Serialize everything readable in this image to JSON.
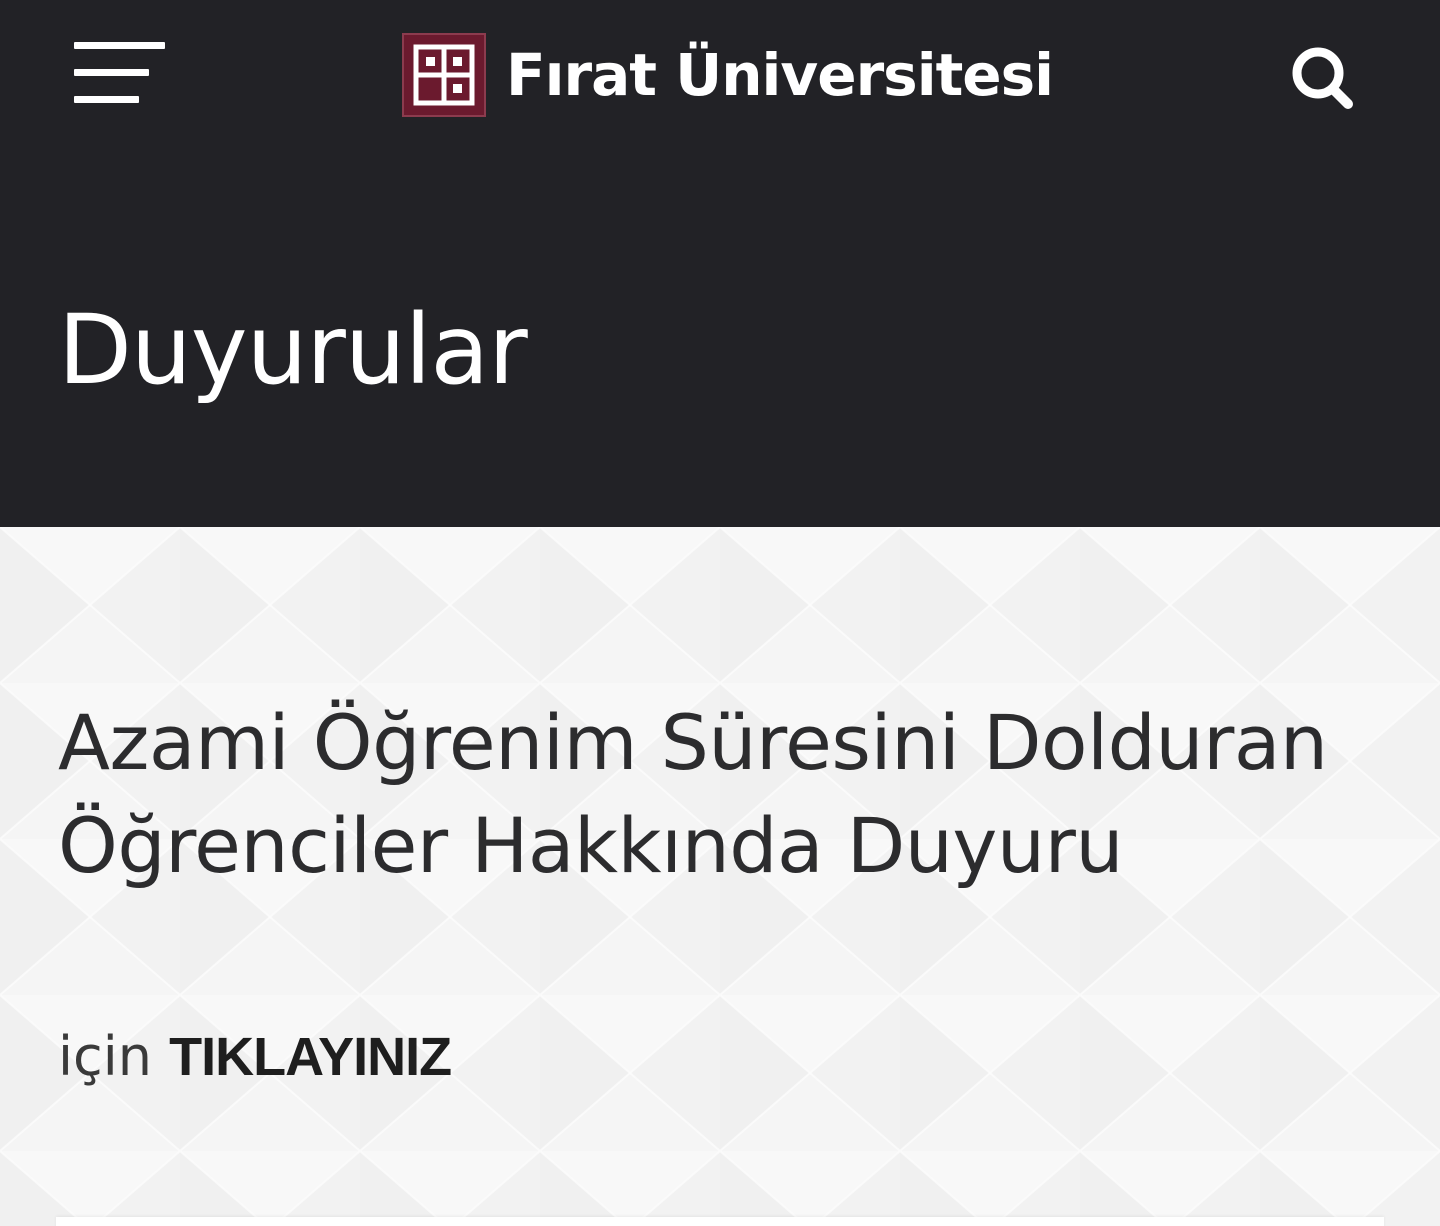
{
  "header": {
    "brand_name": "Fırat Üniversitesi",
    "menu_icon": "hamburger-menu-icon",
    "search_icon": "search-icon",
    "logo_icon": "university-logo-icon",
    "background_color": "#222226",
    "logo_color": "#6b1a2e"
  },
  "hero": {
    "title": "Duyurular"
  },
  "announcement": {
    "title": "Azami Öğrenim Süresini Dolduran Öğrenciler Hakkında Duyuru",
    "prefix": "için",
    "link_label": "TIKLAYINIZ"
  }
}
